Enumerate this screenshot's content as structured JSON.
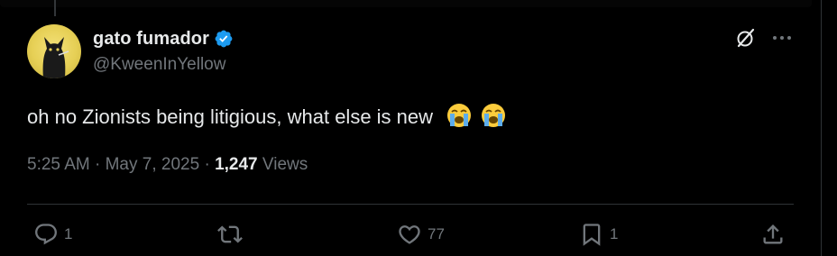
{
  "tweet": {
    "display_name": "gato fumador",
    "handle": "@KweenInYellow",
    "text": "oh no Zionists being litigious, what else is new",
    "emojis": [
      "loudly-crying-face",
      "loudly-crying-face"
    ],
    "time": "5:25 AM",
    "date": "May 7, 2025",
    "separator": "·",
    "views_count": "1,247",
    "views_label": "Views"
  },
  "actions": {
    "reply_count": "1",
    "retweet_count": "",
    "like_count": "77",
    "bookmark_count": "1"
  },
  "colors": {
    "background": "#000000",
    "text": "#e7e9ea",
    "secondary_text": "#71767b",
    "verified": "#1d9bf0",
    "divider": "#2f3336"
  },
  "icons": {
    "grok": "grok-icon",
    "more": "more-dots-icon",
    "verified": "verified-badge-icon",
    "reply": "reply-icon",
    "retweet": "retweet-icon",
    "like": "heart-icon",
    "bookmark": "bookmark-icon",
    "share": "share-icon"
  }
}
